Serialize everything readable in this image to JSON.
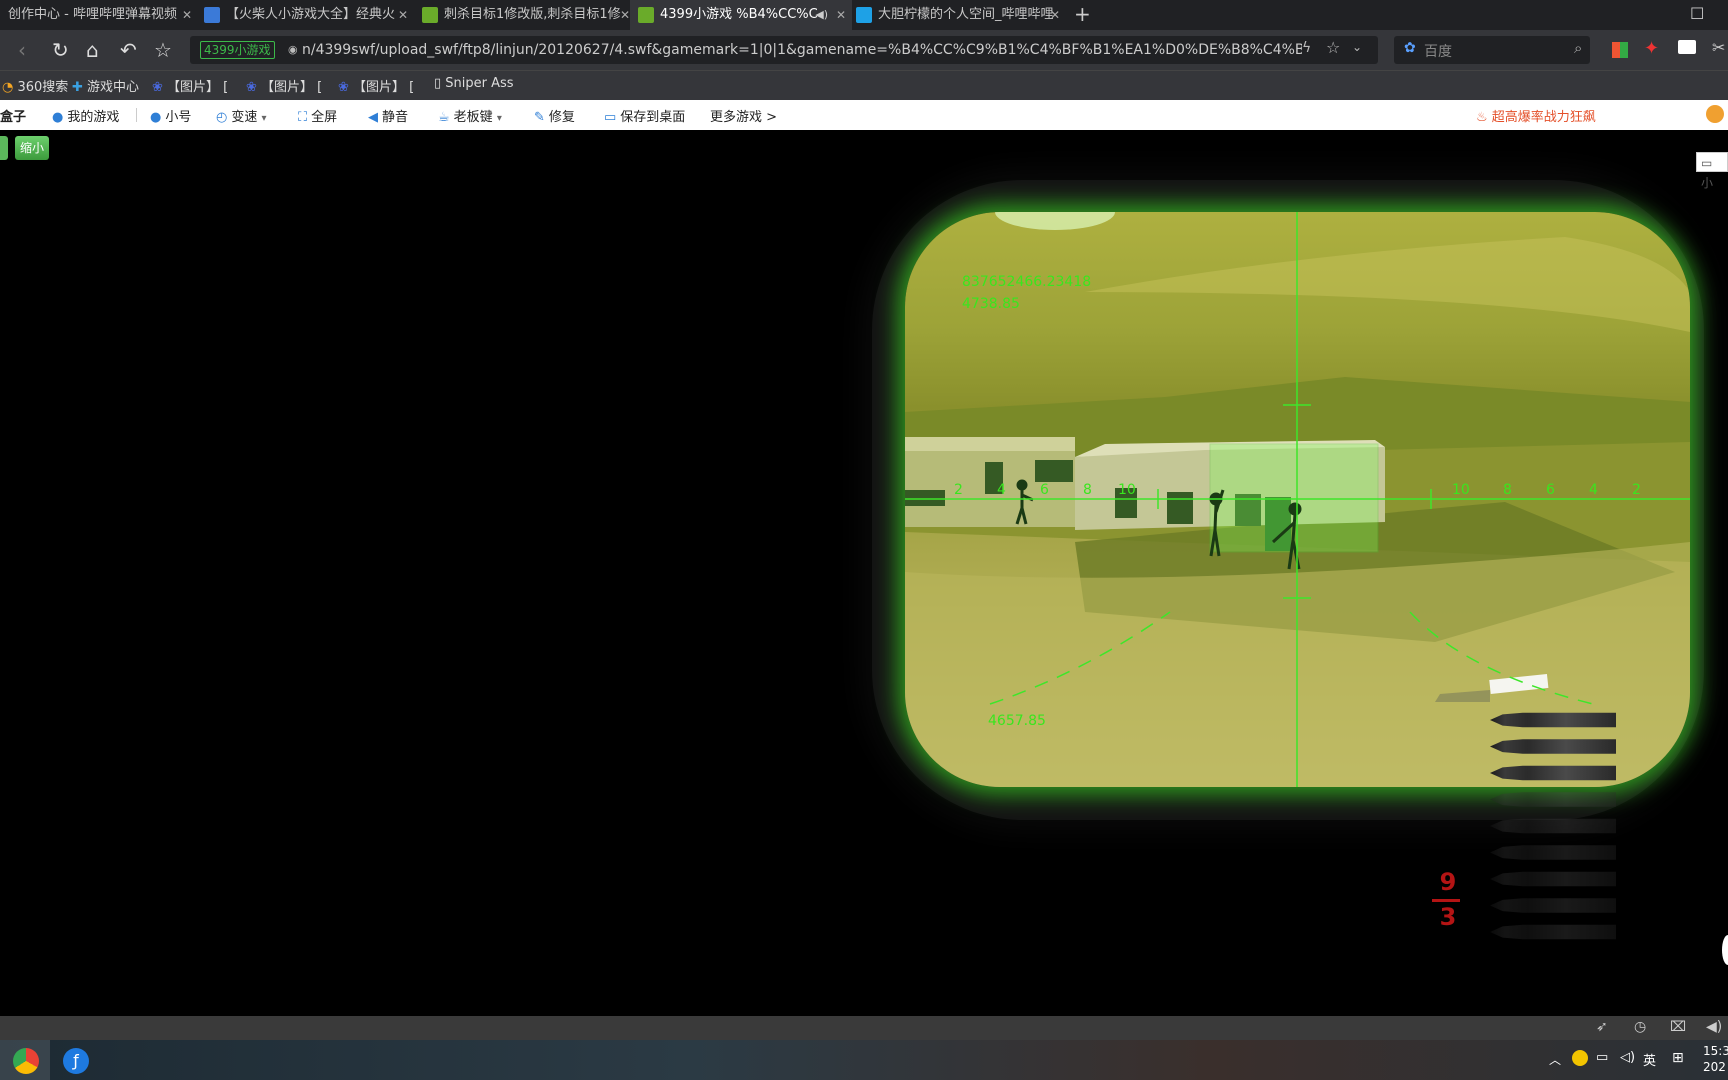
{
  "tabs": [
    {
      "label": "创作中心 - 哔哩哔哩弹幕视频"
    },
    {
      "label": "【火柴人小游戏大全】经典火"
    },
    {
      "label": "刺杀目标1修改版,刺杀目标1修"
    },
    {
      "label": "4399小游戏 %B4%CC%C"
    },
    {
      "label": "大胆柠檬的个人空间_哔哩哔哩"
    }
  ],
  "address": {
    "badge": "4399小游戏",
    "url": "n/4399swf/upload_swf/ftp8/linjun/20120627/4.swf&gamemark=1|0|1&gamename=%B4%CC%C9%B1%C4%BF%B1%EA1%D0%DE%B8%C4%B0%E6"
  },
  "search": {
    "placeholder": "百度"
  },
  "bookmarks": [
    {
      "label": "360搜索"
    },
    {
      "label": "游戏中心"
    },
    {
      "label": "【图片】 ["
    },
    {
      "label": "【图片】 ["
    },
    {
      "label": "【图片】 ["
    },
    {
      "label": "Sniper Ass"
    }
  ],
  "gamebar": {
    "box": "盒子",
    "items": [
      "我的游戏",
      "小号",
      "变速",
      "全屏",
      "静音",
      "老板键",
      "修复",
      "保存到桌面",
      "更多游戏 >"
    ],
    "promo": "超高爆率战力狂飙"
  },
  "game": {
    "shrink_button": "缩小",
    "hud_value_1": "837652466.23418",
    "hud_value_2": "4738.85",
    "hud_distance": "4657.85",
    "mil_left": [
      "2",
      "4",
      "6",
      "8",
      "10"
    ],
    "mil_right": [
      "10",
      "8",
      "6",
      "4",
      "2"
    ],
    "ammo_loaded": "9",
    "ammo_reserve": "3",
    "bullets_bright": 3,
    "bullets_dim": 6
  },
  "colors": {
    "hud": "#39e61e",
    "ammo": "#b41414",
    "scope_glow": "#46ff28"
  },
  "taskbar": {
    "ime": "英",
    "clock_time": "15:3",
    "clock_date": "202"
  }
}
